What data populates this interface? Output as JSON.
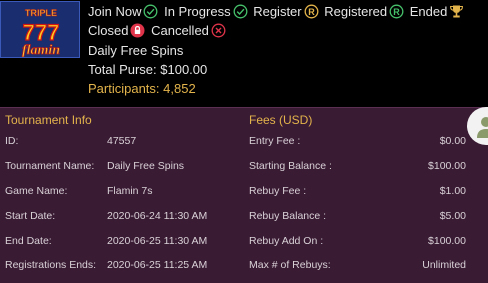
{
  "logo": {
    "alt": "Triple 777 Flamin"
  },
  "legend": [
    {
      "label": "Join Now",
      "icon": "check-circle-icon",
      "color": "#46c16b"
    },
    {
      "label": "In Progress",
      "icon": "check-circle-icon",
      "color": "#46c16b"
    },
    {
      "label": "Register",
      "icon": "r-circle-icon",
      "color": "#e3b44b"
    },
    {
      "label": "Registered",
      "icon": "r-circle-icon",
      "color": "#46c16b"
    },
    {
      "label": "Ended",
      "icon": "trophy-icon",
      "color": "#e3b44b"
    },
    {
      "label": "Closed",
      "icon": "lock-icon",
      "color": "#e0344a"
    },
    {
      "label": "Cancelled",
      "icon": "x-circle-icon",
      "color": "#e0344a"
    }
  ],
  "tournament": {
    "name": "Daily Free Spins",
    "total_purse": "Total Purse: $100.00",
    "participants": "Participants: 4,852"
  },
  "info": {
    "heading": "Tournament Info",
    "rows": [
      {
        "label": "ID:",
        "value": "47557"
      },
      {
        "label": "Tournament Name:",
        "value": "Daily Free Spins"
      },
      {
        "label": "Game Name:",
        "value": "Flamin 7s"
      },
      {
        "label": "Start Date:",
        "value": "2020-06-24 11:30 AM"
      },
      {
        "label": "End Date:",
        "value": "2020-06-25 11:30 AM"
      },
      {
        "label": "Registrations Ends:",
        "value": "2020-06-25 11:25 AM"
      }
    ]
  },
  "fees": {
    "heading": "Fees (USD)",
    "rows": [
      {
        "label": "Entry Fee :",
        "value": "$0.00"
      },
      {
        "label": "Starting Balance :",
        "value": "$100.00"
      },
      {
        "label": "Rebuy Fee :",
        "value": "$1.00"
      },
      {
        "label": "Rebuy Balance :",
        "value": "$5.00"
      },
      {
        "label": "Rebuy Add On :",
        "value": "$100.00"
      },
      {
        "label": "Max # of Rebuys:",
        "value": "Unlimited"
      }
    ]
  },
  "colors": {
    "accent": "#e3b44b",
    "panel_bg": "#3a1b34",
    "green": "#46c16b",
    "red": "#e0344a"
  }
}
